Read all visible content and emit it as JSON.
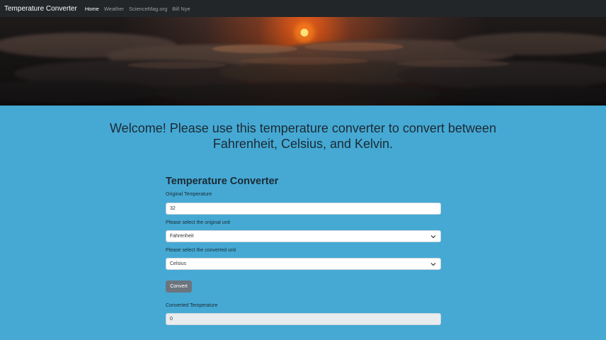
{
  "navbar": {
    "brand": "Temperature Converter",
    "links": [
      {
        "label": "Home",
        "active": true
      },
      {
        "label": "Weather",
        "active": false
      },
      {
        "label": "ScienceMag.org",
        "active": false
      },
      {
        "label": "Bill Nye",
        "active": false
      }
    ]
  },
  "hero": {
    "image": "sunset-clouds"
  },
  "welcome": {
    "line1": "Welcome! Please use this temperature converter to convert between",
    "line2": "Fahrenheit, Celsius, and Kelvin."
  },
  "converter": {
    "title": "Temperature Converter",
    "original_label": "Original Temperature",
    "original_value": "32",
    "original_unit_label": "Please select the original unit",
    "original_unit_value": "Fahrenheit",
    "converted_unit_label": "Please select the converted unit",
    "converted_unit_value": "Celsius",
    "convert_button": "Convert",
    "converted_label": "Converted Temperature",
    "converted_value": "0"
  },
  "colors": {
    "page_background": "#45a9d4",
    "navbar": "#222629",
    "button": "#6c757d"
  }
}
